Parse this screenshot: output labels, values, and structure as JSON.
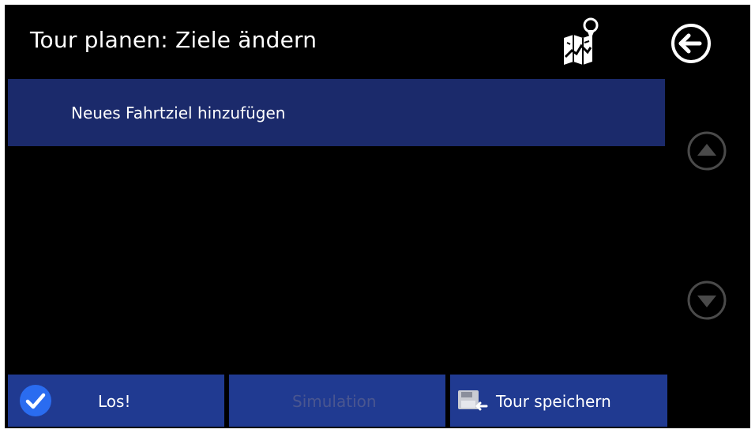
{
  "header": {
    "title": "Tour planen: Ziele ändern",
    "map_icon": "map-pin-icon",
    "back_icon": "back-arrow-icon"
  },
  "list": {
    "items": [
      {
        "label": "Neues Fahrtziel hinzufügen"
      }
    ]
  },
  "scroll": {
    "up_icon": "scroll-up-icon",
    "down_icon": "scroll-down-icon"
  },
  "footer": {
    "go_label": "Los!",
    "simulation_label": "Simulation",
    "save_label": "Tour speichern"
  },
  "colors": {
    "background": "#000000",
    "list_item": "#1b2a6b",
    "button": "#203a91",
    "check_accent": "#2a6cf0",
    "disabled_text": "#4a5690"
  }
}
